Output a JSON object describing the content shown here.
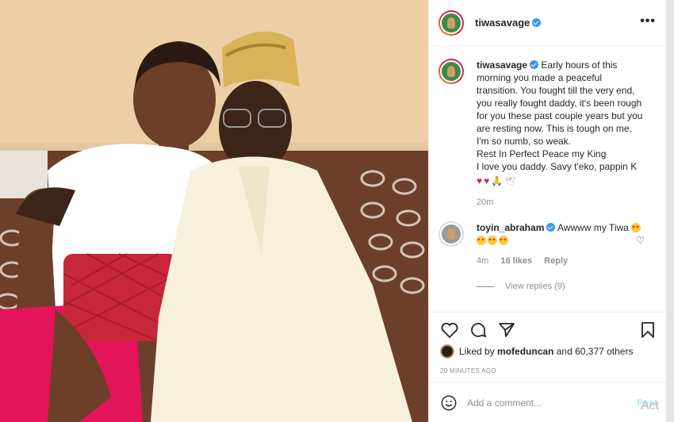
{
  "post": {
    "username": "tiwasavage",
    "more_label": "•••"
  },
  "caption": {
    "username": "tiwasavage",
    "text": "Early hours of this morning you made a peaceful transition. You fought till the very end, you really fought daddy, it's been rough for you these past couple years but you are resting now. This is tough on me, I'm so numb, so weak.\nRest In Perfect Peace my King\nI love you daddy. Savy t'eko, pappin K",
    "emojis": [
      "red-heart",
      "red-heart",
      "praying-hands",
      "dove"
    ],
    "time": "20m"
  },
  "comment": {
    "username": "toyin_abraham",
    "text": "Awwww my Tiwa",
    "emojis": [
      "heart-eyes",
      "heart-eyes",
      "heart-eyes",
      "heart-eyes"
    ],
    "time": "4m",
    "likes": "16 likes",
    "reply_label": "Reply",
    "view_replies": "View replies (9)"
  },
  "likes": {
    "prefix": "Liked by",
    "user": "mofeduncan",
    "suffix": "and 60,377 others"
  },
  "time_ago": "20 MINUTES AGO",
  "add_comment": {
    "placeholder": "Add a comment...",
    "post_label": "Post"
  },
  "icons": [
    "heart-icon",
    "comment-icon",
    "share-icon",
    "bookmark-icon",
    "emoji-icon"
  ],
  "watermark": "Act"
}
